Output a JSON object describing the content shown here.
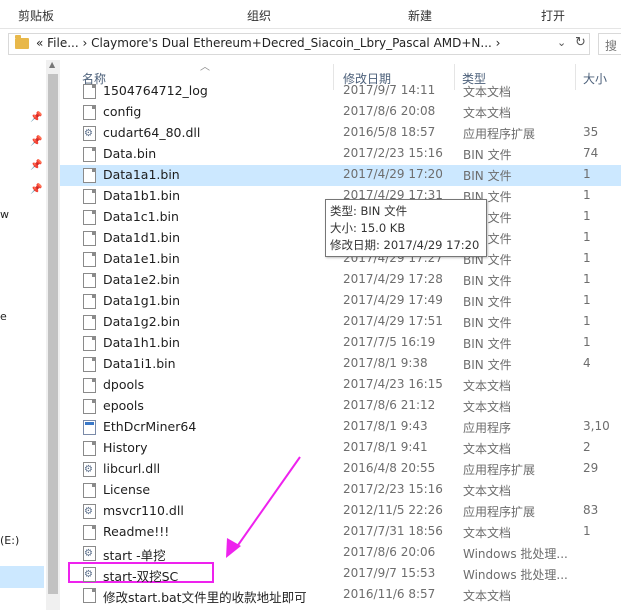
{
  "ribbon": {
    "clipboard": "剪贴板",
    "organize": "组织",
    "new": "新建",
    "open": "打开"
  },
  "address": {
    "path": "«  File...  ›  Claymore's Dual Ethereum+Decred_Siacoin_Lbry_Pascal AMD+N...  ›",
    "search_placeholder": "搜"
  },
  "nav": {
    "frag1": "w",
    "frag2": "e",
    "frag3": "(E:)"
  },
  "columns": {
    "name": "名称",
    "date": "修改日期",
    "type": "类型",
    "size": "大小"
  },
  "files": [
    {
      "name": "1504764712_log",
      "date": "2017/9/7 14:11",
      "type": "文本文档",
      "size": "",
      "icon": "doc-icon"
    },
    {
      "name": "config",
      "date": "2017/8/6 20:08",
      "type": "文本文档",
      "size": "",
      "icon": "doc-icon"
    },
    {
      "name": "cudart64_80.dll",
      "date": "2016/5/8 18:57",
      "type": "应用程序扩展",
      "size": "35",
      "icon": "gear-doc-icon"
    },
    {
      "name": "Data.bin",
      "date": "2017/2/23 15:16",
      "type": "BIN 文件",
      "size": "74",
      "icon": "doc-icon"
    },
    {
      "name": "Data1a1.bin",
      "date": "2017/4/29 17:20",
      "type": "BIN 文件",
      "size": "1",
      "icon": "doc-icon"
    },
    {
      "name": "Data1b1.bin",
      "date": "2017/4/29 17:31",
      "type": "BIN 文件",
      "size": "1",
      "icon": "doc-icon"
    },
    {
      "name": "Data1c1.bin",
      "date": "",
      "type": "BIN 文件",
      "size": "1",
      "icon": "doc-icon"
    },
    {
      "name": "Data1d1.bin",
      "date": "",
      "type": "BIN 文件",
      "size": "1",
      "icon": "doc-icon"
    },
    {
      "name": "Data1e1.bin",
      "date": "2017/4/29 17:27",
      "type": "BIN 文件",
      "size": "1",
      "icon": "doc-icon"
    },
    {
      "name": "Data1e2.bin",
      "date": "2017/4/29 17:28",
      "type": "BIN 文件",
      "size": "1",
      "icon": "doc-icon"
    },
    {
      "name": "Data1g1.bin",
      "date": "2017/4/29 17:49",
      "type": "BIN 文件",
      "size": "1",
      "icon": "doc-icon"
    },
    {
      "name": "Data1g2.bin",
      "date": "2017/4/29 17:51",
      "type": "BIN 文件",
      "size": "1",
      "icon": "doc-icon"
    },
    {
      "name": "Data1h1.bin",
      "date": "2017/7/5 16:19",
      "type": "BIN 文件",
      "size": "1",
      "icon": "doc-icon"
    },
    {
      "name": "Data1i1.bin",
      "date": "2017/8/1 9:38",
      "type": "BIN 文件",
      "size": "4",
      "icon": "doc-icon"
    },
    {
      "name": "dpools",
      "date": "2017/4/23 16:15",
      "type": "文本文档",
      "size": "",
      "icon": "doc-icon"
    },
    {
      "name": "epools",
      "date": "2017/8/6 21:12",
      "type": "文本文档",
      "size": "",
      "icon": "doc-icon"
    },
    {
      "name": "EthDcrMiner64",
      "date": "2017/8/1 9:43",
      "type": "应用程序",
      "size": "3,10",
      "icon": "exe-icon"
    },
    {
      "name": "History",
      "date": "2017/8/1 9:41",
      "type": "文本文档",
      "size": "2",
      "icon": "doc-icon"
    },
    {
      "name": "libcurl.dll",
      "date": "2016/4/8 20:55",
      "type": "应用程序扩展",
      "size": "29",
      "icon": "gear-doc-icon"
    },
    {
      "name": "License",
      "date": "2017/2/23 15:16",
      "type": "文本文档",
      "size": "",
      "icon": "doc-icon"
    },
    {
      "name": "msvcr110.dll",
      "date": "2012/11/5 22:26",
      "type": "应用程序扩展",
      "size": "83",
      "icon": "gear-doc-icon"
    },
    {
      "name": "Readme!!!",
      "date": "2017/7/31 18:56",
      "type": "文本文档",
      "size": "1",
      "icon": "doc-icon"
    },
    {
      "name": "start -单挖",
      "date": "2017/8/6 20:06",
      "type": "Windows 批处理...",
      "size": "",
      "icon": "gear-doc-icon"
    },
    {
      "name": "start-双挖SC",
      "date": "2017/9/7 15:53",
      "type": "Windows 批处理...",
      "size": "",
      "icon": "gear-doc-icon"
    },
    {
      "name": "修改start.bat文件里的收款地址即可",
      "date": "2016/11/6 8:57",
      "type": "文本文档",
      "size": "",
      "icon": "doc-icon"
    }
  ],
  "tooltip": {
    "type": "类型: BIN 文件",
    "size": "大小: 15.0 KB",
    "modified": "修改日期: 2017/4/29 17:20"
  },
  "annotation": {
    "arrow_color": "#ee22ee",
    "selection_color": "#cce8ff"
  }
}
